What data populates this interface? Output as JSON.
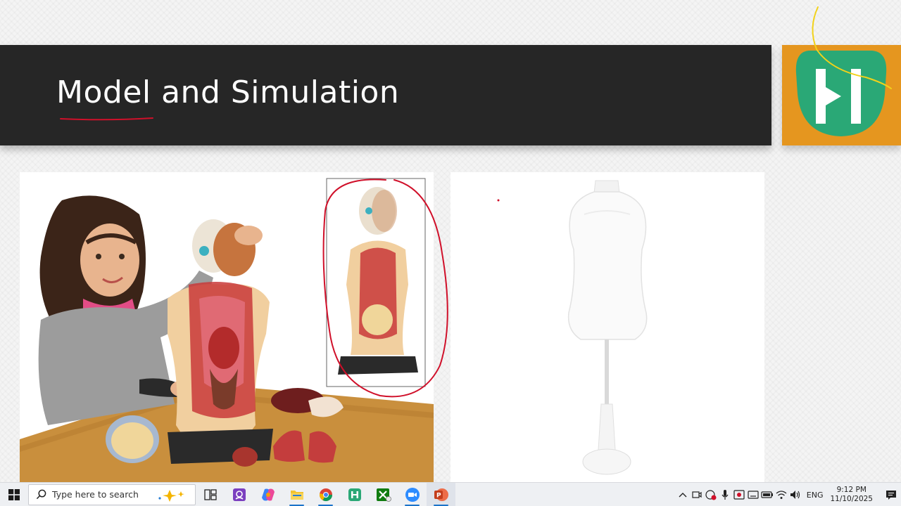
{
  "slide": {
    "title": "Model and Simulation"
  },
  "taskbar": {
    "search_placeholder": "Type here to search",
    "apps": [
      "task-view",
      "contacts-app",
      "copilot",
      "file-explorer",
      "chrome",
      "h-app",
      "xbox",
      "zoom",
      "powerpoint"
    ],
    "tray": {
      "language": "ENG",
      "time": "9:12 PM",
      "date": "11/10/2025"
    }
  },
  "colors": {
    "title_bar": "#262626",
    "logo_bg": "#e5961f",
    "logo_green": "#2aa876",
    "ink_red": "#d0102a",
    "ink_yellow": "#f2d21a"
  }
}
